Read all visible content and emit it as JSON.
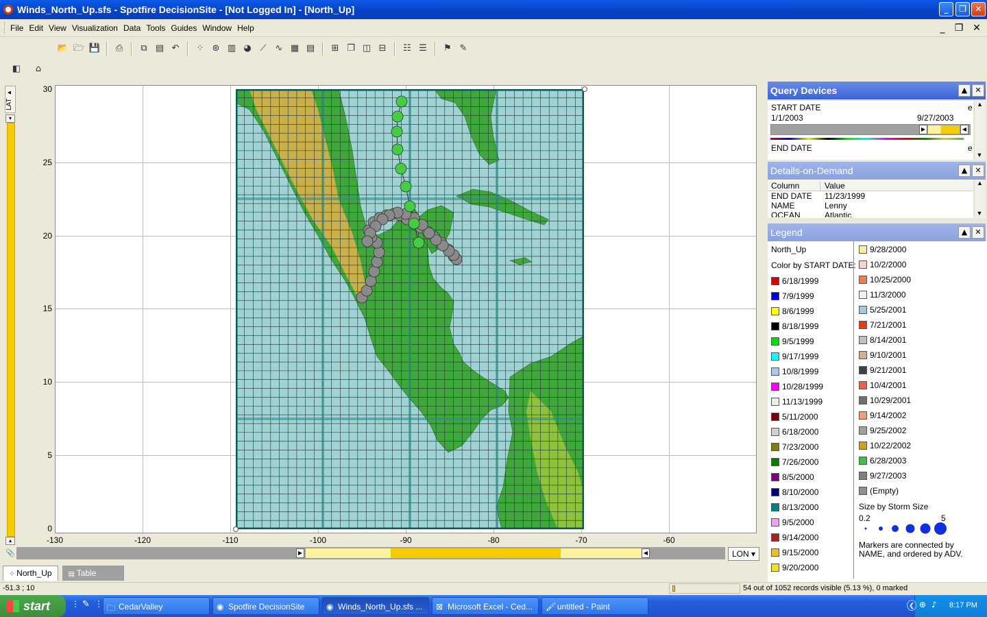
{
  "window": {
    "title": "Winds_North_Up.sfs - Spotfire DecisionSite - [Not Logged In] - [North_Up]"
  },
  "menu": [
    "File",
    "Edit",
    "View",
    "Visualization",
    "Data",
    "Tools",
    "Guides",
    "Window",
    "Help"
  ],
  "axis": {
    "y_label": "LAT",
    "y_ticks": [
      "30",
      "25",
      "20",
      "15",
      "10",
      "5",
      "0"
    ],
    "x_ticks": [
      "-130",
      "-120",
      "-110",
      "-100",
      "-90",
      "-80",
      "-70",
      "-60"
    ],
    "x_selector": "LON"
  },
  "tabs": [
    {
      "label": "North_Up",
      "active": true
    },
    {
      "label": "Table",
      "active": false
    }
  ],
  "query_devices": {
    "title": "Query Devices",
    "start_date": {
      "label": "START DATE",
      "min": "1/1/2003",
      "max": "9/27/2003",
      "suffix": "e"
    },
    "end_date": {
      "label": "END DATE",
      "suffix": "e"
    }
  },
  "details": {
    "title": "Details-on-Demand",
    "columns": [
      "Column",
      "Value"
    ],
    "rows": [
      {
        "column": "END DATE",
        "value": "11/23/1999"
      },
      {
        "column": "NAME",
        "value": "Lenny"
      },
      {
        "column": "OCEAN",
        "value": "Atlantic"
      }
    ]
  },
  "legend": {
    "title": "Legend",
    "subtitle": "North_Up",
    "color_by": "Color by START DATE:",
    "left_items": [
      {
        "label": "6/18/1999",
        "color": "#e00000"
      },
      {
        "label": "7/9/1999",
        "color": "#0000e0"
      },
      {
        "label": "8/6/1999",
        "color": "#ffff00"
      },
      {
        "label": "8/18/1999",
        "color": "#000000"
      },
      {
        "label": "9/5/1999",
        "color": "#00e000"
      },
      {
        "label": "9/17/1999",
        "color": "#00ffff"
      },
      {
        "label": "10/8/1999",
        "color": "#a8c8f0"
      },
      {
        "label": "10/28/1999",
        "color": "#ff00ff"
      },
      {
        "label": "11/13/1999",
        "color": "#e8f0e0"
      },
      {
        "label": "5/11/2000",
        "color": "#800000"
      },
      {
        "label": "6/18/2000",
        "color": "#d0d0d0"
      },
      {
        "label": "7/23/2000",
        "color": "#808000"
      },
      {
        "label": "7/26/2000",
        "color": "#008000"
      },
      {
        "label": "8/5/2000",
        "color": "#800080"
      },
      {
        "label": "8/10/2000",
        "color": "#000080"
      },
      {
        "label": "8/13/2000",
        "color": "#008080"
      },
      {
        "label": "9/5/2000",
        "color": "#f0a0f0"
      },
      {
        "label": "9/14/2000",
        "color": "#b02020"
      },
      {
        "label": "9/15/2000",
        "color": "#f0c020"
      },
      {
        "label": "9/20/2000",
        "color": "#f0e020"
      }
    ],
    "right_items": [
      {
        "label": "9/28/2000",
        "color": "#f0f0a0"
      },
      {
        "label": "10/2/2000",
        "color": "#f8d0d0"
      },
      {
        "label": "10/25/2000",
        "color": "#f08050"
      },
      {
        "label": "11/3/2000",
        "color": "#f0f0f0"
      },
      {
        "label": "5/25/2001",
        "color": "#a0c8e0"
      },
      {
        "label": "7/21/2001",
        "color": "#e04010"
      },
      {
        "label": "8/14/2001",
        "color": "#c0c0c0"
      },
      {
        "label": "9/10/2001",
        "color": "#d0b090"
      },
      {
        "label": "9/21/2001",
        "color": "#404040"
      },
      {
        "label": "10/4/2001",
        "color": "#f06050"
      },
      {
        "label": "10/29/2001",
        "color": "#707070"
      },
      {
        "label": "9/14/2002",
        "color": "#f0a070"
      },
      {
        "label": "9/25/2002",
        "color": "#a0a0a0"
      },
      {
        "label": "10/22/2002",
        "color": "#d0a020"
      },
      {
        "label": "6/28/2003",
        "color": "#40c040"
      },
      {
        "label": "9/27/2003",
        "color": "#808080"
      },
      {
        "label": "(Empty)",
        "color": "#909090"
      }
    ],
    "size_by": "Size by Storm Size",
    "size_min": "0.2",
    "size_max": "5",
    "note_line1": "Markers are connected by",
    "note_line2": "NAME, and ordered by ADV.",
    "marker_color": "#1030e0"
  },
  "status": {
    "coords": "-51.3 ; 10",
    "records": "54 out of 1052 records visible (5.13 %), 0 marked"
  },
  "taskbar": {
    "start": "start",
    "tasks": [
      {
        "label": "CedarValley",
        "icon": "folder-icon",
        "active": false
      },
      {
        "label": "Spotfire DecisionSite",
        "icon": "spotfire-icon",
        "active": false
      },
      {
        "label": "Winds_North_Up.sfs ...",
        "icon": "spotfire-icon",
        "active": true
      },
      {
        "label": "Microsoft Excel - Ced...",
        "icon": "excel-icon",
        "active": false
      },
      {
        "label": "untitled - Paint",
        "icon": "paint-icon",
        "active": false
      }
    ],
    "clock": "8:17 PM"
  },
  "map_colors": {
    "ocean": "#9fd2d2",
    "land_low": "#3fa83a",
    "land_mid": "#8ec23a",
    "land_high": "#c9b04a",
    "grid": "#223333",
    "track_green": "#44cc44",
    "track_gray": "#8a8a8a"
  }
}
